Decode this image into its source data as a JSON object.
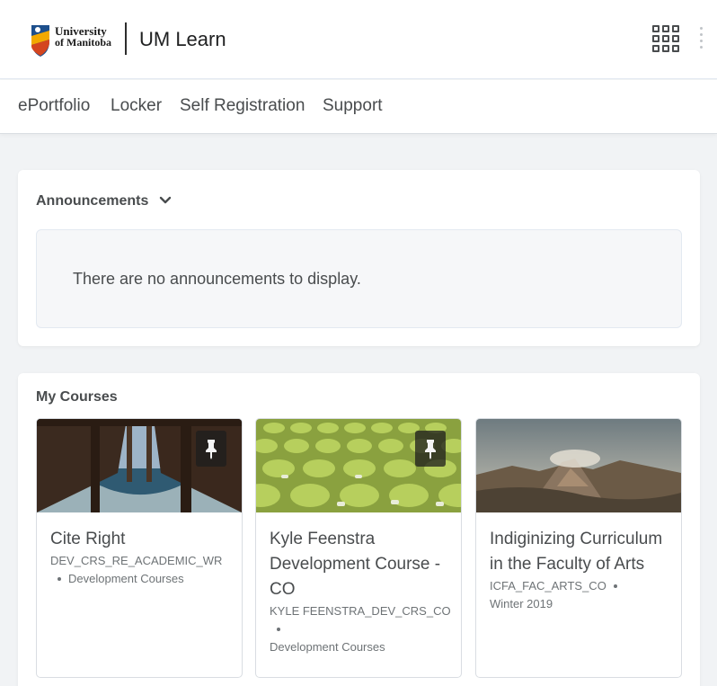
{
  "header": {
    "logo": {
      "line1": "University",
      "line2": "of Manitoba"
    },
    "site_title": "UM Learn",
    "apps_icon": "waffle-grid-icon",
    "menu_icon": "kebab-menu-icon"
  },
  "nav": {
    "items": [
      {
        "label": "ePortfolio"
      },
      {
        "label": "Locker"
      },
      {
        "label": "Self Registration"
      },
      {
        "label": "Support"
      }
    ]
  },
  "announcements": {
    "title": "Announcements",
    "toggle_icon": "chevron-down-icon",
    "empty_message": "There are no announcements to display."
  },
  "my_courses": {
    "title": "My Courses",
    "courses": [
      {
        "name": "Cite Right",
        "code": "DEV_CRS_RE_ACADEMIC_WR",
        "category": "Development Courses",
        "pinned": true,
        "image": "pier-underside-ocean"
      },
      {
        "name": "Kyle Feenstra Development Course - CO",
        "code": "KYLE FEENSTRA_DEV_CRS_CO",
        "category": "Development Courses",
        "pinned": true,
        "image": "green-stadium-seats"
      },
      {
        "name": "Indiginizing Curriculum in the Faculty of Arts",
        "code": "ICFA_FAC_ARTS_CO",
        "category": "Winter 2019",
        "pinned": false,
        "image": "volcano-landscape"
      }
    ]
  },
  "colors": {
    "accent": "#494c4e",
    "border": "#d9dde2",
    "background": "#f1f3f5"
  }
}
